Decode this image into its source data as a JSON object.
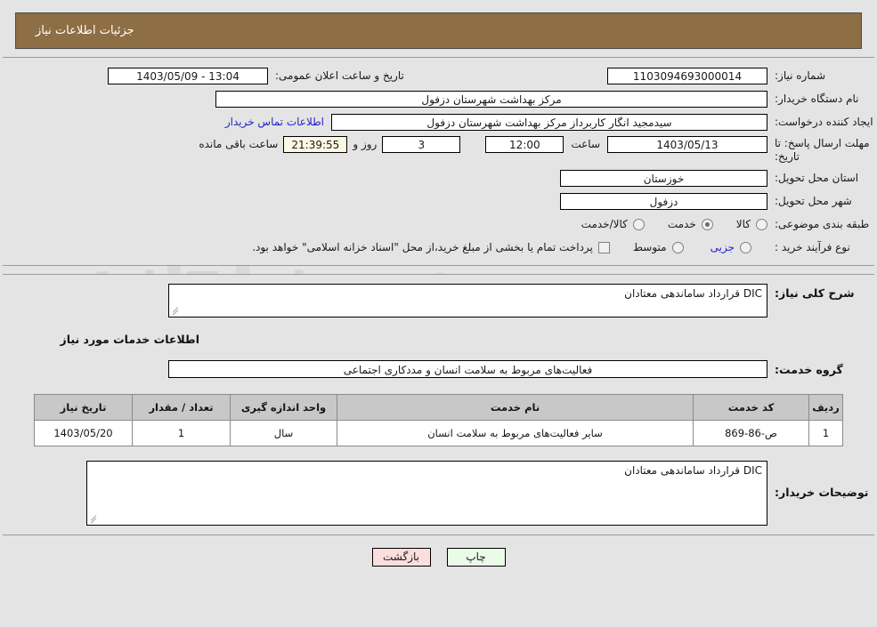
{
  "window": {
    "title": "جزئیات اطلاعات نیاز",
    "title_bg": "#8d6e45"
  },
  "watermark": {
    "text": "AriaTender.net"
  },
  "summary": {
    "need_number_label": "شماره نیاز:",
    "need_number_value": "1103094693000014",
    "buyer_org_label": "نام دستگاه خریدار:",
    "buyer_org_value": "مرکز بهداشت شهرستان دزفول",
    "creator_label": "ایجاد کننده درخواست:",
    "creator_value": "سیدمجید انگار کاربرداز مرکز بهداشت شهرستان دزفول",
    "deadline_label": "مهلت ارسال پاسخ: تا تاریخ:",
    "deadline_date": "1403/05/13",
    "deadline_time_label": "ساعت",
    "deadline_time": "12:00",
    "province_label": "استان محل تحویل:",
    "province_value": "خوزستان",
    "city_label": "شهر محل تحویل:",
    "city_value": "دزفول",
    "announce_label": "تاریخ و ساعت اعلان عمومی:",
    "announce_value": "1403/05/09 - 13:04",
    "contact_link": "اطلاعات تماس خریدار",
    "remaining_days": "3",
    "remaining_days_label": "روز و",
    "remaining_clock": "21:39:55",
    "remaining_clock_label": "ساعت باقی مانده"
  },
  "classification": {
    "label": "طبقه بندی موضوعی:",
    "options": [
      {
        "label": "کالا",
        "selected": false
      },
      {
        "label": "خدمت",
        "selected": true
      },
      {
        "label": "کالا/خدمت",
        "selected": false
      }
    ]
  },
  "process_type": {
    "label": "نوع فرآیند خرید :",
    "options": [
      {
        "label": "جزیی",
        "selected": false,
        "blue": true
      },
      {
        "label": "متوسط",
        "selected": false,
        "blue": false
      }
    ],
    "checkbox_label": "پرداخت تمام یا بخشی از مبلغ خرید،از محل \"اسناد خزانه اسلامی\" خواهد بود.",
    "checkbox_checked": false
  },
  "details": {
    "need_desc_label": "شرح کلی نیاز:",
    "need_desc_value": "DIC قرارداد ساماندهی معتادان",
    "services_heading": "اطلاعات خدمات مورد نیاز",
    "service_group_label": "گروه خدمت:",
    "service_group_value": "فعالیت‌های مربوط به سلامت انسان و مددکاری اجتماعی"
  },
  "items_table": {
    "headers": [
      "ردیف",
      "کد خدمت",
      "نام خدمت",
      "واحد اندازه گیری",
      "تعداد / مقدار",
      "تاریخ نیاز"
    ],
    "rows": [
      {
        "index": "1",
        "code": "ص-86-869",
        "name": "سایر فعالیت‌های مربوط به سلامت انسان",
        "unit": "سال",
        "qty": "1",
        "date": "1403/05/20"
      }
    ]
  },
  "buyer_notes": {
    "label": "توضیحات خریدار:",
    "value": "DIC قرارداد ساماندهی معتادان"
  },
  "footer": {
    "print_label": "چاپ",
    "back_label": "بازگشت"
  }
}
